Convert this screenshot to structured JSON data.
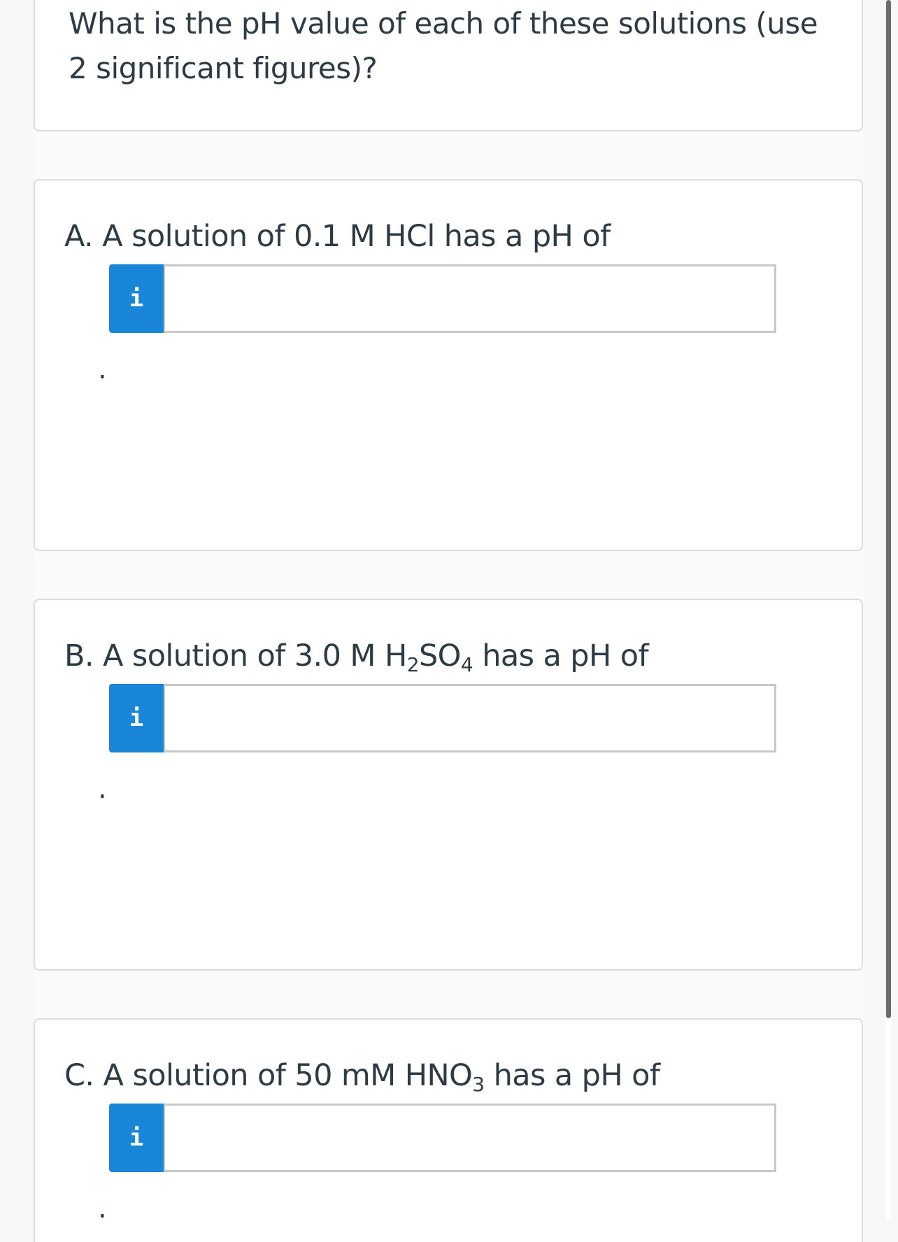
{
  "intro": {
    "text": "What is the pH value of each of these solutions (use 2 significant figures)?"
  },
  "questions": [
    {
      "id": "A",
      "prefix": "A. A solution of 0.1 M HCl has a pH of",
      "info_label": "i",
      "input_value": "",
      "trailing": "."
    },
    {
      "id": "B",
      "part1": "B. A solution of 3.0 M H",
      "sub1": "2",
      "part2": "SO",
      "sub2": "4",
      "part3": " has a pH of",
      "info_label": "i",
      "input_value": "",
      "trailing": "."
    },
    {
      "id": "C",
      "part1": "C. A solution of 50 mM HNO",
      "sub1": "3",
      "part2": " has a pH of",
      "info_label": "i",
      "input_value": "",
      "trailing": "."
    }
  ],
  "colors": {
    "info_button": "#1a86d8",
    "text": "#2d3b45",
    "border": "#dcdcdc"
  },
  "icons": {
    "info": "info-icon"
  }
}
